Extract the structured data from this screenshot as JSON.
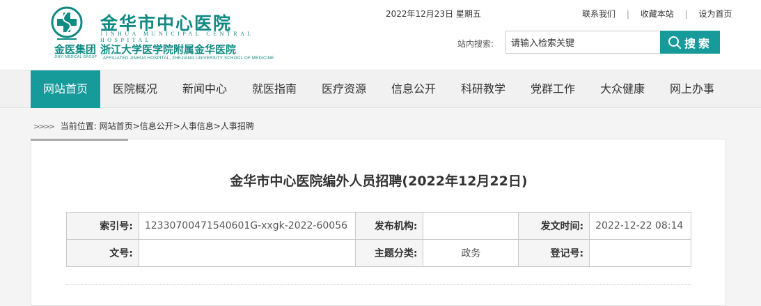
{
  "hospital": {
    "name": "金华市中心医院",
    "name_en": "JINHUA MUNICIPAL CENTRAL HOSPITAL",
    "group_name": "金医集团",
    "group_en": "JINYI MEDICAL GROUP",
    "affiliation": "浙江大学医学院附属金华医院",
    "affiliation_en": "AFFILIATED JINHUA HOSPITAL, ZHEJIANG UNIVERSITY SCHOOL OF MEDICINE",
    "brand_color": "#0f8a83"
  },
  "header": {
    "date": "2022年12月23日 星期五",
    "links": [
      "联系我们",
      "收藏本站",
      "设为首页"
    ],
    "search_label": "站内搜索:",
    "search_placeholder": "请输入检索关键",
    "search_button": "搜索"
  },
  "nav": {
    "items": [
      "网站首页",
      "医院概况",
      "新闻中心",
      "就医指南",
      "医疗资源",
      "信息公开",
      "科研教学",
      "党群工作",
      "大众健康",
      "网上办事"
    ],
    "active": "网站首页",
    "accent_color": "#169a9a"
  },
  "breadcrumb": {
    "prefix": "当前位置:",
    "path": [
      "网站首页",
      "信息公开",
      "人事信息",
      "人事招聘"
    ]
  },
  "article": {
    "title": "金华市中心医院编外人员招聘(2022年12月22日)",
    "meta": {
      "index_label": "索引号:",
      "index_value": "12330700471540601G-xxgk-2022-60056",
      "publisher_label": "发布机构:",
      "publisher_value": "",
      "date_label": "发文时间:",
      "date_value": "2022-12-22 08:14",
      "docno_label": "文号:",
      "docno_value": "",
      "category_label": "主题分类:",
      "category_value": "政务",
      "regno_label": "登记号:",
      "regno_value": ""
    }
  }
}
